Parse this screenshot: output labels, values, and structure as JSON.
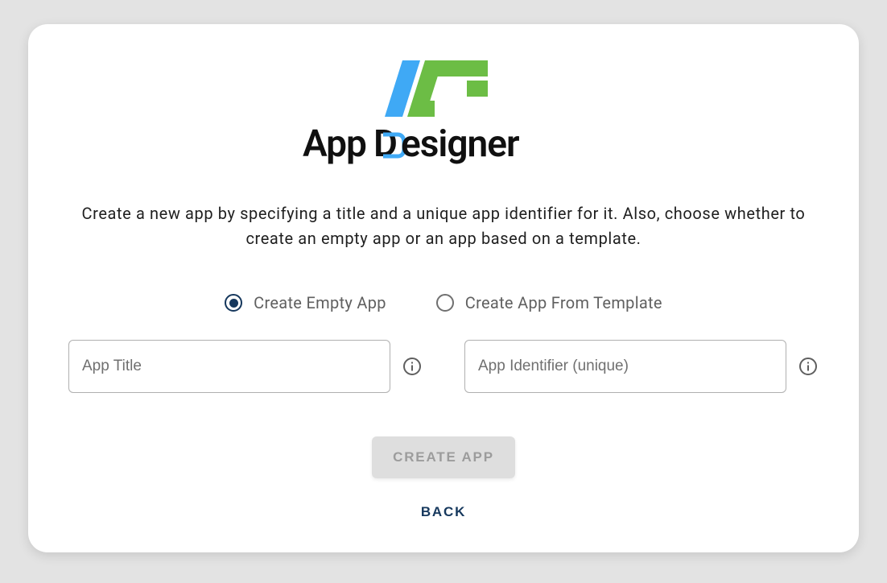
{
  "brand": {
    "app_text": "App",
    "designer_text": "esigner"
  },
  "intro": "Create a new app by specifying a title and a unique app identifier for it. Also, choose whether to create an empty app or an app based on a template.",
  "options": {
    "empty": {
      "label": "Create Empty App",
      "selected": true
    },
    "template": {
      "label": "Create App From Template",
      "selected": false
    }
  },
  "fields": {
    "title": {
      "placeholder": "App Title",
      "value": ""
    },
    "identifier": {
      "placeholder": "App Identifier (unique)",
      "value": ""
    }
  },
  "buttons": {
    "create": "CREATE APP",
    "back": "BACK"
  },
  "colors": {
    "brand_blue": "#3fa9f5",
    "brand_green": "#6cbd45",
    "deep_navy": "#16385d"
  }
}
